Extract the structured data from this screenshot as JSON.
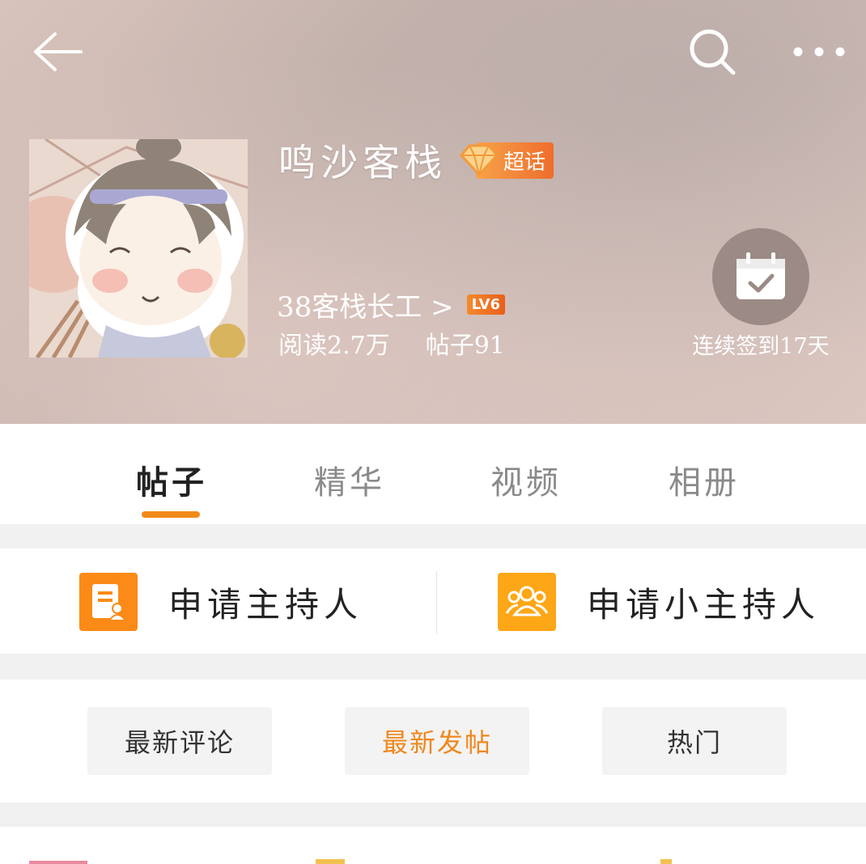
{
  "header": {
    "title": "鸣沙客栈",
    "badge_label": "超话",
    "rank_text": "38客栈长工 >",
    "level": "LV6",
    "reads": "阅读2.7万",
    "posts": "帖子91",
    "checkin_text": "连续签到17天"
  },
  "tabs": [
    {
      "label": "帖子",
      "active": true
    },
    {
      "label": "精华",
      "active": false
    },
    {
      "label": "视频",
      "active": false
    },
    {
      "label": "相册",
      "active": false
    }
  ],
  "apply": {
    "host_label": "申请主持人",
    "small_host_label": "申请小主持人"
  },
  "sort": [
    {
      "label": "最新评论",
      "active": false
    },
    {
      "label": "最新发帖",
      "active": true
    },
    {
      "label": "热门",
      "active": false
    }
  ],
  "colors": {
    "accent": "#f28a1b",
    "icon_orange": "#fb8a16",
    "icon_yellow": "#fda716"
  }
}
